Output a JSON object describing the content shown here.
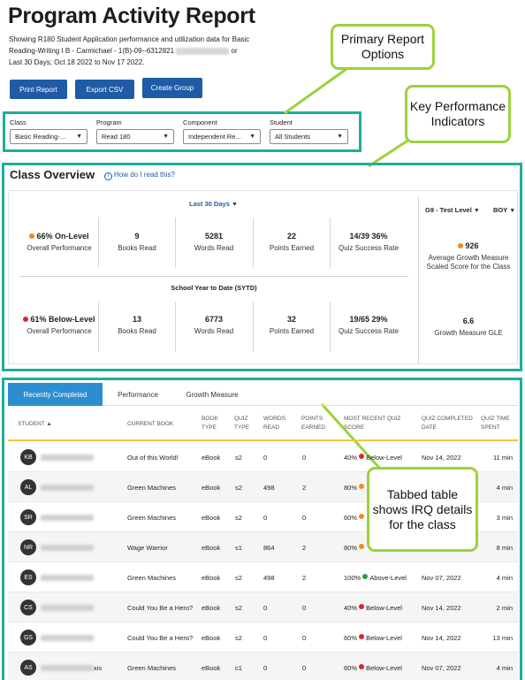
{
  "page": {
    "title": "Program Activity Report",
    "description_1": "Showing R180 Student Application performance and utilization data for Basic",
    "description_2": "Reading-Writing I B - Carmichael - 1(B)-09--6312821",
    "description_2b": "or",
    "description_3": "Last 30 Days; Oct 18 2022 to Nov 17 2022."
  },
  "buttons": {
    "print": "Print Report",
    "export": "Export CSV",
    "create_group": "Create Group"
  },
  "filters": [
    {
      "label": "Class",
      "value": "Basic Reading-..."
    },
    {
      "label": "Program",
      "value": "Read 180"
    },
    {
      "label": "Component",
      "value": "Independent Re..."
    },
    {
      "label": "Student",
      "value": "All Students"
    }
  ],
  "callouts": {
    "primary": "Primary Report Options",
    "kpi": "Key Performance Indicators",
    "table": "Tabbed table shows IRQ details for the class"
  },
  "overview": {
    "title": "Class Overview",
    "help": "How do I read this?",
    "period_select": "Last 30 Days",
    "sytd_label": "School Year to Date (SYTD)",
    "level_select": "G9 - Test Level",
    "boy_select": "BOY",
    "last30": [
      {
        "value": "66% On-Level",
        "label": "Overall Performance",
        "dot": "#f08a1d"
      },
      {
        "value": "9",
        "label": "Books Read"
      },
      {
        "value": "5281",
        "label": "Words Read"
      },
      {
        "value": "22",
        "label": "Points Earned"
      },
      {
        "value": "14/39 36%",
        "label": "Quiz Success Rate"
      }
    ],
    "sytd": [
      {
        "value": "61% Below-Level",
        "label": "Overall Performance",
        "dot": "#d8262b"
      },
      {
        "value": "13",
        "label": "Books Read"
      },
      {
        "value": "6773",
        "label": "Words Read"
      },
      {
        "value": "32",
        "label": "Points Earned"
      },
      {
        "value": "19/65 29%",
        "label": "Quiz Success Rate"
      }
    ],
    "growth": {
      "score": "926",
      "score_label_1": "Average Growth Measure",
      "score_label_2": "Scaled Score for the Class",
      "gle": "6.6",
      "gle_label": "Growth Measure GLE"
    }
  },
  "tabs": [
    "Recently Completed",
    "Performance",
    "Growth Measure"
  ],
  "table": {
    "headers": {
      "student": "STUDENT",
      "current_book": "CURRENT BOOK",
      "book_type_1": "BOOK",
      "book_type_2": "TYPE",
      "quiz_type_1": "QUIZ",
      "quiz_type_2": "TYPE",
      "words_1": "WORDS",
      "words_2": "READ",
      "points_1": "POINTS",
      "points_2": "EARNED",
      "score_1": "MOST RECENT QUIZ",
      "score_2": "SCORE",
      "date_1": "QUIZ COMPLETED",
      "date_2": "DATE",
      "time_1": "QUIZ TIME",
      "time_2": "SPENT"
    },
    "rows": [
      {
        "initials": "KB",
        "book": "Out of this World!",
        "type": "eBook",
        "quiz": "s2",
        "words": "0",
        "points": "0",
        "score": "40%",
        "level": "Below-Level",
        "dot": "#d8262b",
        "date": "Nov 14, 2022",
        "time": "11 min"
      },
      {
        "initials": "AL",
        "book": "Green Machines",
        "type": "eBook",
        "quiz": "s2",
        "words": "498",
        "points": "2",
        "score": "80%",
        "level": "",
        "dot": "#f08a1d",
        "date": "",
        "time": "4 min"
      },
      {
        "initials": "SR",
        "book": "Green Machines",
        "type": "eBook",
        "quiz": "s2",
        "words": "0",
        "points": "0",
        "score": "60%",
        "level": "",
        "dot": "#f08a1d",
        "date": "",
        "time": "3 min"
      },
      {
        "initials": "NR",
        "book": "Wage Warrior",
        "type": "eBook",
        "quiz": "s1",
        "words": "864",
        "points": "2",
        "score": "80%",
        "level": "",
        "dot": "#f08a1d",
        "date": "",
        "time": "8 min"
      },
      {
        "initials": "ES",
        "book": "Green Machines",
        "type": "eBook",
        "quiz": "s2",
        "words": "498",
        "points": "2",
        "score": "100%",
        "level": "Above-Level",
        "dot": "#2e9b3a",
        "date": "Nov 07, 2022",
        "time": "4 min"
      },
      {
        "initials": "CS",
        "book": "Could You Be a Hero?",
        "type": "eBook",
        "quiz": "s2",
        "words": "0",
        "points": "0",
        "score": "40%",
        "level": "Below-Level",
        "dot": "#d8262b",
        "date": "Nov 14, 2022",
        "time": "2 min"
      },
      {
        "initials": "GS",
        "book": "Could You Be a Hero?",
        "type": "eBook",
        "quiz": "s2",
        "words": "0",
        "points": "0",
        "score": "60%",
        "level": "Below-Level",
        "dot": "#d8262b",
        "date": "Nov 14, 2022",
        "time": "13 min"
      },
      {
        "initials": "AS",
        "book": "Green Machines",
        "type": "eBook",
        "quiz": "c1",
        "words": "0",
        "points": "0",
        "score": "60%",
        "level": "Below-Level",
        "dot": "#d8262b",
        "date": "Nov 07, 2022",
        "time": "4 min"
      }
    ],
    "row8_name_suffix": "xis"
  },
  "colors": {
    "accent_blue": "#1f5ba6",
    "teal_frame": "#1fae9a",
    "callout_green": "#9bd23c",
    "tab_active": "#2c8ed1",
    "header_rule": "#f0c63d"
  }
}
